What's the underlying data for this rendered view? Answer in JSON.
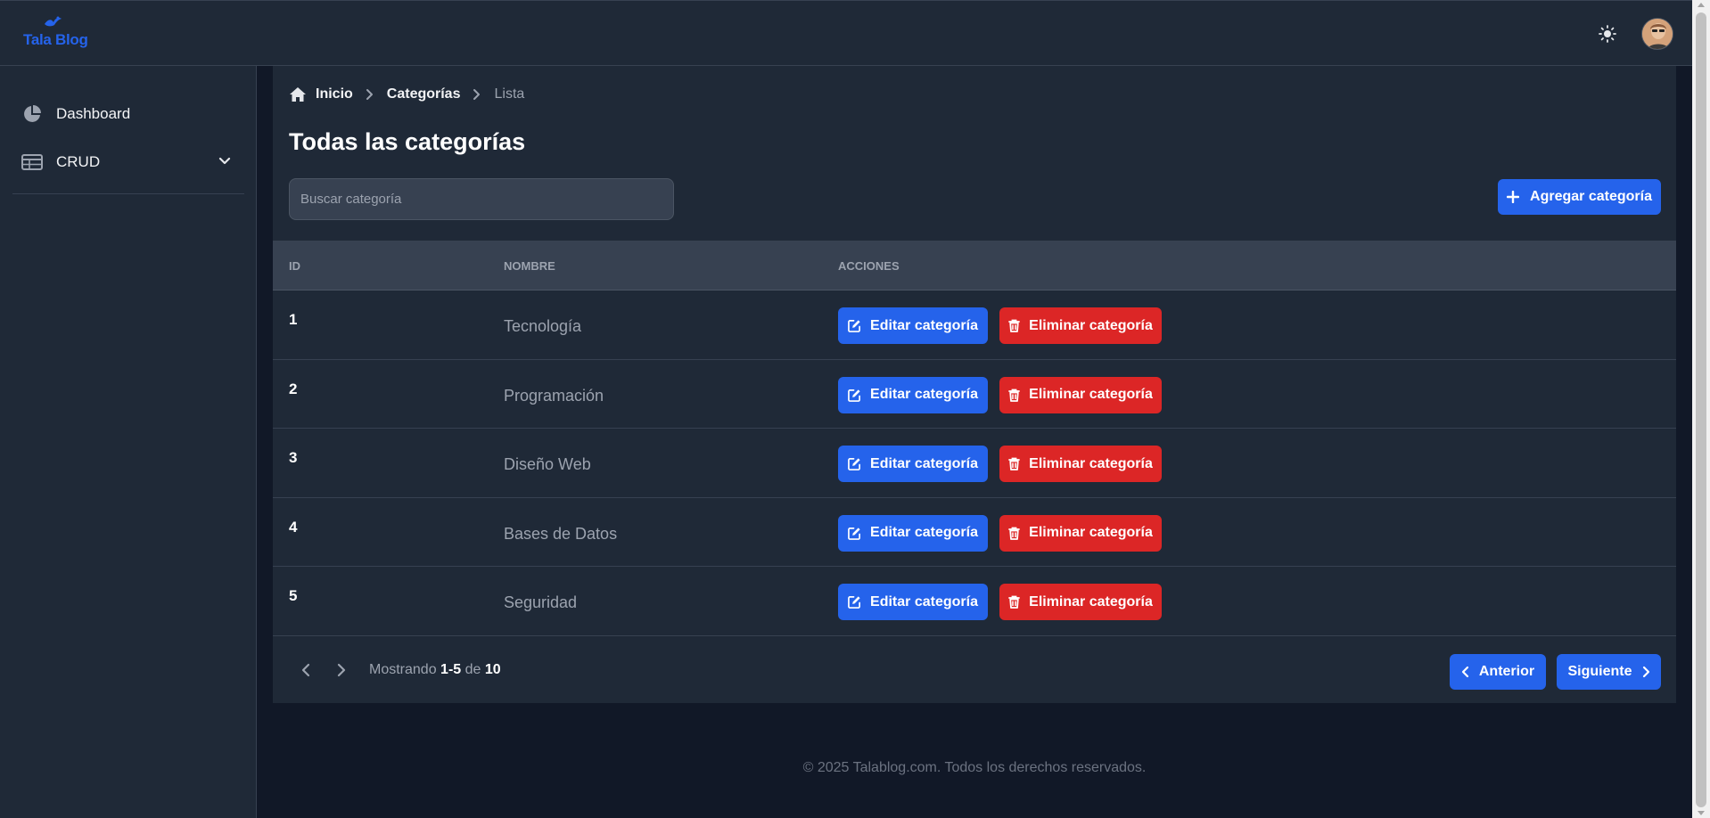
{
  "topbar": {
    "logo_text": "Tala Blog",
    "theme_icon": "sun-icon",
    "avatar_icon": "user-avatar"
  },
  "sidebar": {
    "items": [
      {
        "label": "Dashboard",
        "icon": "pie-chart-icon"
      },
      {
        "label": "CRUD",
        "icon": "table-icon",
        "expand_icon": "chevron-down-icon"
      }
    ]
  },
  "breadcrumb": {
    "home": "Inicio",
    "level1": "Categorías",
    "current": "Lista"
  },
  "page": {
    "title": "Todas las categorías",
    "search_placeholder": "Buscar categoría",
    "add_button": "Agregar categoría"
  },
  "table": {
    "headers": {
      "id": "ID",
      "name": "NOMBRE",
      "actions": "ACCIONES"
    },
    "edit_label": "Editar categoría",
    "delete_label": "Eliminar categoría",
    "rows": [
      {
        "id": "1",
        "name": "Tecnología"
      },
      {
        "id": "2",
        "name": "Programación"
      },
      {
        "id": "3",
        "name": "Diseño Web"
      },
      {
        "id": "4",
        "name": "Bases de Datos"
      },
      {
        "id": "5",
        "name": "Seguridad"
      }
    ]
  },
  "pagination": {
    "prefix": "Mostrando",
    "range": "1-5",
    "of": "de",
    "total": "10",
    "prev": "Anterior",
    "next": "Siguiente"
  },
  "footer": {
    "copyright": "© 2025 Talablog.com. Todos los derechos reservados."
  },
  "colors": {
    "accent_blue": "#2563eb",
    "danger_red": "#dc2626",
    "surface": "#1f2937",
    "background": "#111827"
  }
}
